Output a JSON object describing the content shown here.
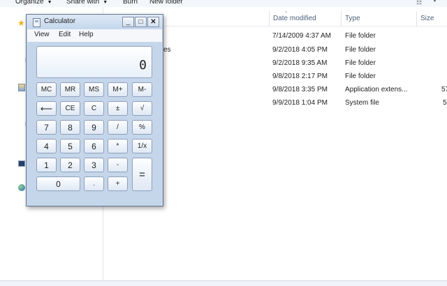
{
  "explorer": {
    "toolbar": {
      "organize": "Organize",
      "share_with": "Share with",
      "burn": "Burn",
      "new_folder": "New folder"
    },
    "columns": {
      "date_modified": "Date modified",
      "type": "Type",
      "size": "Size"
    },
    "name_fragment": "es",
    "rows": [
      {
        "date": "7/14/2009 4:37 AM",
        "type": "File folder",
        "size": ""
      },
      {
        "date": "9/2/2018 4:05 PM",
        "type": "File folder",
        "size": ""
      },
      {
        "date": "9/2/2018 9:35 AM",
        "type": "File folder",
        "size": ""
      },
      {
        "date": "9/8/2018 2:17 PM",
        "type": "File folder",
        "size": ""
      },
      {
        "date": "9/8/2018 3:35 PM",
        "type": "Application extens...",
        "size": "57"
      },
      {
        "date": "9/9/2018 1:04 PM",
        "type": "System file",
        "size": "5"
      }
    ],
    "nav_icons": [
      "favorites-star-icon",
      "libraries-icon",
      "computer-icon",
      "network-icon"
    ]
  },
  "calculator": {
    "title": "Calculator",
    "window_buttons": {
      "minimize": "_",
      "maximize": "□",
      "close": "✕"
    },
    "menu": {
      "view": "View",
      "edit": "Edit",
      "help": "Help"
    },
    "display": "0",
    "keys": {
      "mc": "MC",
      "mr": "MR",
      "ms": "MS",
      "mplus": "M+",
      "mminus": "M-",
      "backspace": "⟵",
      "ce": "CE",
      "c": "C",
      "plusminus": "±",
      "sqrt": "√",
      "d7": "7",
      "d8": "8",
      "d9": "9",
      "divide": "/",
      "percent": "%",
      "d4": "4",
      "d5": "5",
      "d6": "6",
      "multiply": "*",
      "reciprocal": "1/x",
      "d1": "1",
      "d2": "2",
      "d3": "3",
      "minus": "-",
      "equals": "=",
      "d0": "0",
      "decimal": ".",
      "plus": "+"
    }
  }
}
